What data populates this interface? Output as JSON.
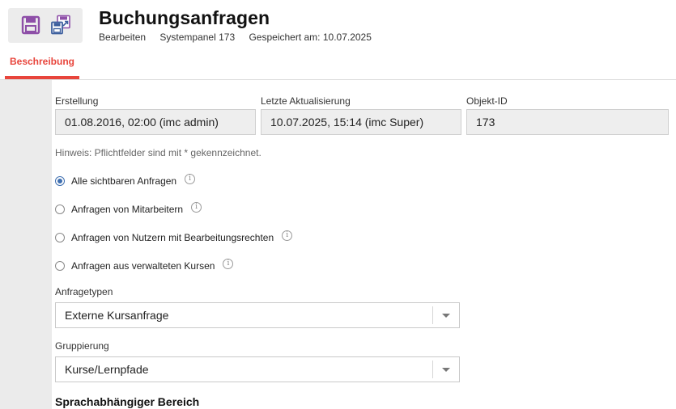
{
  "toolbar": {
    "save_icon": "floppy-disk-icon",
    "save_as_icon": "save-as-copy-icon",
    "colors": {
      "icon_purple": "#8e4fa8",
      "icon_blue": "#3d5f9e"
    }
  },
  "header": {
    "title": "Buchungsanfragen",
    "meta": [
      "Bearbeiten",
      "Systempanel 173",
      "Gespeichert am: 10.07.2025"
    ]
  },
  "tabs": [
    {
      "label": "Beschreibung",
      "active": true
    }
  ],
  "accent_color": "#e8453c",
  "info_fields": [
    {
      "label": "Erstellung",
      "value": "01.08.2016, 02:00 (imc admin)"
    },
    {
      "label": "Letzte Aktualisierung",
      "value": "10.07.2025, 15:14 (imc Super)"
    },
    {
      "label": "Objekt-ID",
      "value": "173"
    }
  ],
  "hint": "Hinweis: Pflichtfelder sind mit * gekennzeichnet.",
  "scope_options": [
    {
      "label": "Alle sichtbaren Anfragen",
      "checked": true,
      "icon": "info-icon"
    },
    {
      "label": "Anfragen von Mitarbeitern",
      "checked": false,
      "icon": "info-icon"
    },
    {
      "label": "Anfragen von Nutzern mit Bearbeitungsrechten",
      "checked": false,
      "icon": "info-icon"
    },
    {
      "label": "Anfragen aus verwalteten Kursen",
      "checked": false,
      "icon": "info-icon"
    }
  ],
  "info_glyph": "i",
  "request_types": {
    "label": "Anfragetypen",
    "value": "Externe Kursanfrage"
  },
  "grouping": {
    "label": "Gruppierung",
    "value": "Kurse/Lernpfade"
  },
  "language_section": {
    "heading": "Sprachabhängiger Bereich"
  }
}
